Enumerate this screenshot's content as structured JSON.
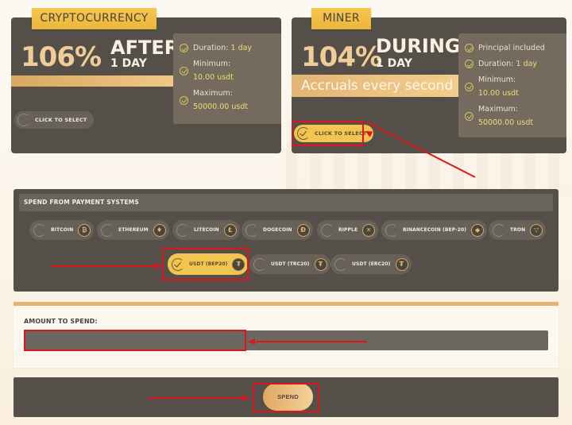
{
  "plans": [
    {
      "tag": "CRYPTOCURRENCY",
      "percent": "106%",
      "headline": "AFTER",
      "period": "1 DAY",
      "band_text": "",
      "features": [
        {
          "label": "Duration:",
          "value": "1 day",
          "inline": true
        },
        {
          "label": "Minimum:",
          "value": "10.00 usdt",
          "inline": false
        },
        {
          "label": "Maximum:",
          "value": "50000.00 usdt",
          "inline": false
        }
      ],
      "select_label": "CLICK TO SELECT",
      "selected": false
    },
    {
      "tag": "MINER",
      "percent": "104%",
      "headline": "DURING",
      "period": "1 DAY",
      "band_text": "Accruals every second",
      "features": [
        {
          "label": "Principal included",
          "value": "",
          "inline": true
        },
        {
          "label": "Duration:",
          "value": "1 day",
          "inline": true
        },
        {
          "label": "Minimum:",
          "value": "10.00 usdt",
          "inline": false
        },
        {
          "label": "Maximum:",
          "value": "50000.00 usdt",
          "inline": false
        }
      ],
      "select_label": "CLICK TO SELECT",
      "selected": true
    }
  ],
  "payment": {
    "title": "SPEND FROM PAYMENT SYSTEMS",
    "systems": [
      {
        "label": "BITCOIN",
        "icon": "bitcoin-icon",
        "glyph": "₿",
        "selected": false
      },
      {
        "label": "ETHEREUM",
        "icon": "ethereum-icon",
        "glyph": "♦",
        "selected": false
      },
      {
        "label": "LITECOIN",
        "icon": "litecoin-icon",
        "glyph": "Ł",
        "selected": false
      },
      {
        "label": "DOGECOIN",
        "icon": "dogecoin-icon",
        "glyph": "Ð",
        "selected": false
      },
      {
        "label": "RIPPLE",
        "icon": "ripple-icon",
        "glyph": "✕",
        "selected": false
      },
      {
        "label": "BINANCECOIN (BEP-20)",
        "icon": "binance-icon",
        "glyph": "◆",
        "selected": false
      },
      {
        "label": "TRON",
        "icon": "tron-icon",
        "glyph": "▽",
        "selected": false
      },
      {
        "label": "USDT (BEP20)",
        "icon": "tether-icon",
        "glyph": "₮",
        "selected": true
      },
      {
        "label": "USDT (TRC20)",
        "icon": "tether-icon",
        "glyph": "₮",
        "selected": false
      },
      {
        "label": "USDT (ERC20)",
        "icon": "tether-icon",
        "glyph": "₮",
        "selected": false
      }
    ]
  },
  "amount": {
    "label": "AMOUNT TO SPEND:",
    "value": "",
    "placeholder": ""
  },
  "spend": {
    "button_label": "SPEND"
  },
  "colors": {
    "panel": "#544f49",
    "accent_gold": "#f2c551",
    "annotation_red": "#e0141b"
  }
}
